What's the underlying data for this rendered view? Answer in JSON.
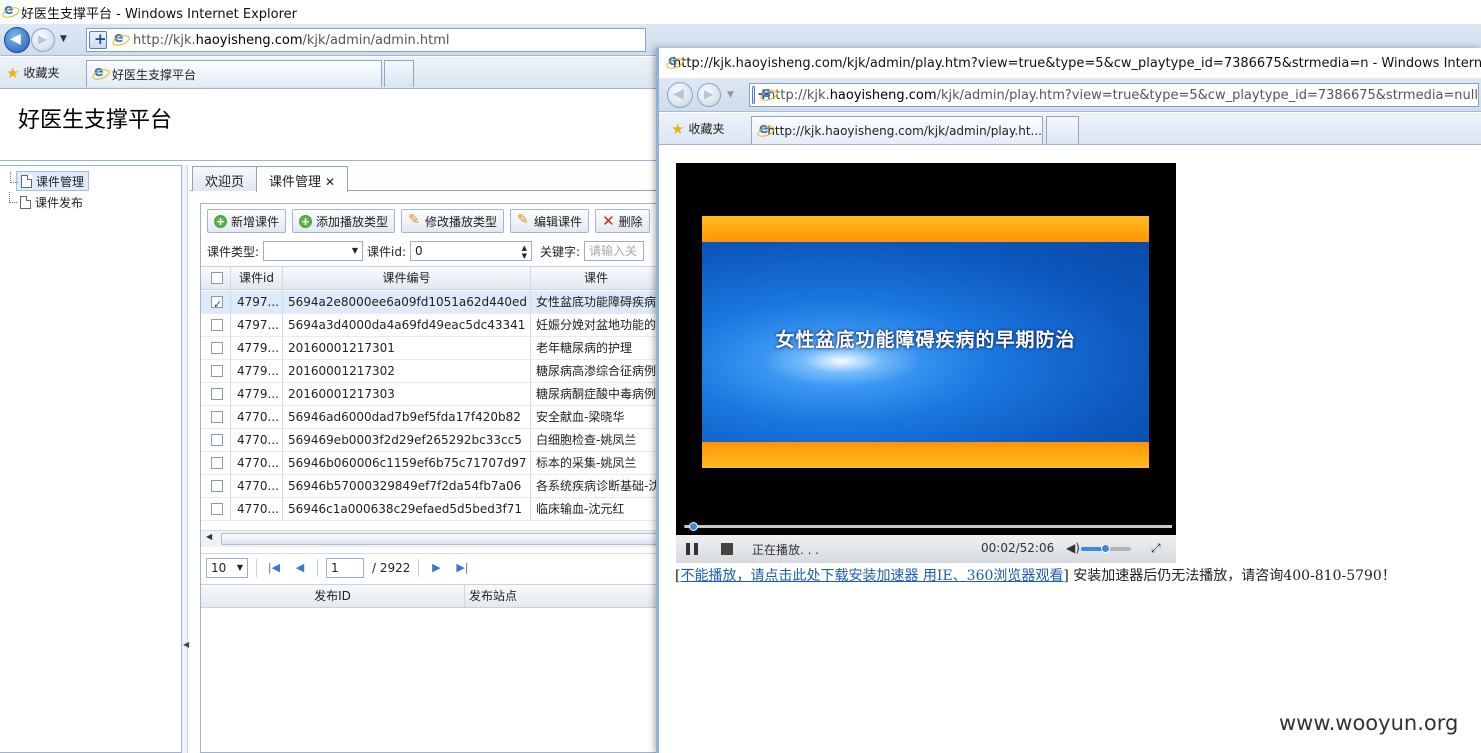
{
  "main_window": {
    "title": "好医生支撑平台 - Windows Internet Explorer",
    "url_pre": "http://kjk.",
    "url_host": "haoyisheng.com",
    "url_post": "/kjk/admin/admin.html",
    "favorites_label": "收藏夹",
    "tab_label": "好医生支撑平台"
  },
  "app": {
    "title": "好医生支撑平台",
    "sidebar": {
      "items": [
        {
          "label": "课件管理"
        },
        {
          "label": "课件发布"
        }
      ]
    },
    "tabs": [
      {
        "label": "欢迎页"
      },
      {
        "label": "课件管理",
        "close": "✕"
      }
    ],
    "toolbar": {
      "add_course": "新增课件",
      "add_play_type": "添加播放类型",
      "edit_play_type": "修改播放类型",
      "edit_course": "编辑课件",
      "delete": "删除"
    },
    "filter": {
      "type_label": "课件类型:",
      "type_value": "",
      "id_label": "课件id:",
      "id_value": "0",
      "keyword_label": "关键字:",
      "keyword_placeholder": "请输入关"
    },
    "grid": {
      "columns": [
        "课件id",
        "课件编号",
        "课件"
      ],
      "rows": [
        {
          "checked": true,
          "id": "4797...",
          "code": "5694a2e8000ee6a09fd1051a62d440ed",
          "name": "女性盆底功能障碍疾病"
        },
        {
          "checked": false,
          "id": "4797...",
          "code": "5694a3d4000da4a69fd49eac5dc43341",
          "name": "妊娠分娩对盆地功能的"
        },
        {
          "checked": false,
          "id": "4779...",
          "code": "20160001217301",
          "name": "老年糖尿病的护理"
        },
        {
          "checked": false,
          "id": "4779...",
          "code": "20160001217302",
          "name": "糖尿病高渗综合征病例"
        },
        {
          "checked": false,
          "id": "4779...",
          "code": "20160001217303",
          "name": "糖尿病酮症酸中毒病例"
        },
        {
          "checked": false,
          "id": "4770...",
          "code": "56946ad6000dad7b9ef5fda17f420b82",
          "name": "安全献血-梁晓华"
        },
        {
          "checked": false,
          "id": "4770...",
          "code": "569469eb0003f2d29ef265292bc33cc5",
          "name": "白细胞检查-姚凤兰"
        },
        {
          "checked": false,
          "id": "4770...",
          "code": "56946b060006c1159ef6b75c71707d97",
          "name": "标本的采集-姚凤兰"
        },
        {
          "checked": false,
          "id": "4770...",
          "code": "56946b57000329849ef7f2da54fb7a06",
          "name": "各系统疾病诊断基础-沈"
        },
        {
          "checked": false,
          "id": "4770...",
          "code": "56946c1a000638c29efaed5d5bed3f71",
          "name": "临床输血-沈元红"
        }
      ]
    },
    "pager": {
      "page_size": "10",
      "current_page": "1",
      "total_pages": "/ 2922"
    },
    "sub_grid": {
      "columns": [
        "发布ID",
        "发布站点"
      ]
    }
  },
  "popup": {
    "title": "http://kjk.haoyisheng.com/kjk/admin/play.htm?view=true&type=5&cw_playtype_id=7386675&strmedia=n - Windows Internet Explorer",
    "url_pre": "http://kjk.",
    "url_host": "haoyisheng.com",
    "url_post": "/kjk/admin/play.htm?view=true&type=5&cw_playtype_id=7386675&strmedia=null",
    "favorites_label": "收藏夹",
    "tab_label": "http://kjk.haoyisheng.com/kjk/admin/play.ht...",
    "video_title": "女性盆底功能障碍疾病的早期防治",
    "player": {
      "status": "正在播放. . .",
      "time": "00:02/52:06",
      "progress_fraction": 0.0006,
      "volume_fraction": 0.5
    },
    "notice_bracket_open": "[",
    "notice_link": "不能播放，请点击此处下载安装加速器 用IE、360浏览器观看",
    "notice_text": "] 安装加速器后仍无法播放，请咨询400-810-5790！"
  },
  "watermark": "www.wooyun.org",
  "colors": {
    "accent": "#1a5fb4",
    "selection": "#dceaf9",
    "video_blue": "#1c6fd0",
    "video_orange": "#ffa010"
  },
  "icons": [
    "ie-logo",
    "back-icon",
    "forward-icon",
    "favorites-star-icon",
    "add-icon",
    "edit-icon",
    "delete-icon",
    "document-icon",
    "pause-icon",
    "stop-icon",
    "volume-icon",
    "fullscreen-icon"
  ]
}
